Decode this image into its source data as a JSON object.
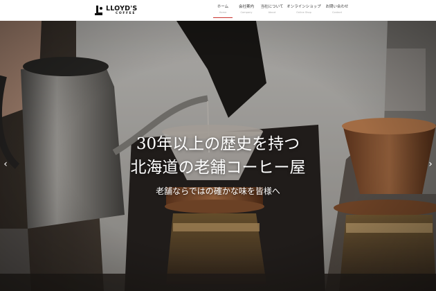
{
  "brand": {
    "name": "LLOYD'S",
    "sub": "COFFEE"
  },
  "nav": [
    {
      "label": "ホーム",
      "sub": "Home",
      "active": true
    },
    {
      "label": "会社案内",
      "sub": "Company"
    },
    {
      "label": "当社について",
      "sub": "About"
    },
    {
      "label": "オンラインショップ",
      "sub": "Online Shop"
    },
    {
      "label": "お問い合わせ",
      "sub": "Contact"
    }
  ],
  "hero": {
    "title_line1": "30年以上の歴史を持つ",
    "title_line2": "北海道の老舗コーヒー屋",
    "subtitle": "老舗ならではの確かな味を皆様へ",
    "prev_arrow": "‹",
    "next_arrow": "›"
  },
  "colors": {
    "accent": "#c9302c",
    "header_bg": "#ffffff",
    "hero_text": "#ffffff"
  }
}
